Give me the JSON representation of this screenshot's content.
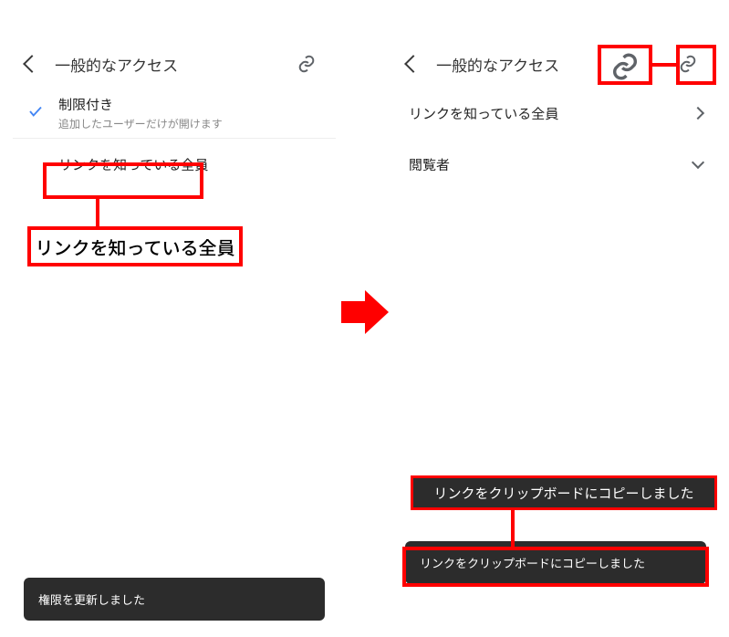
{
  "left": {
    "header_title": "一般的なアクセス",
    "option_restricted": "制限付き",
    "option_restricted_sub": "追加したユーザーだけが開けます",
    "option_anyone": "リンクを知っている全員",
    "toast": "権限を更新しました"
  },
  "right": {
    "header_title": "一般的なアクセス",
    "row_anyone": "リンクを知っている全員",
    "row_role": "閲覧者",
    "toast": "リンクをクリップボードにコピーしました"
  },
  "annot": {
    "label_anyone": "リンクを知っている全員",
    "label_copied": "リンクをクリップボードにコピーしました"
  }
}
